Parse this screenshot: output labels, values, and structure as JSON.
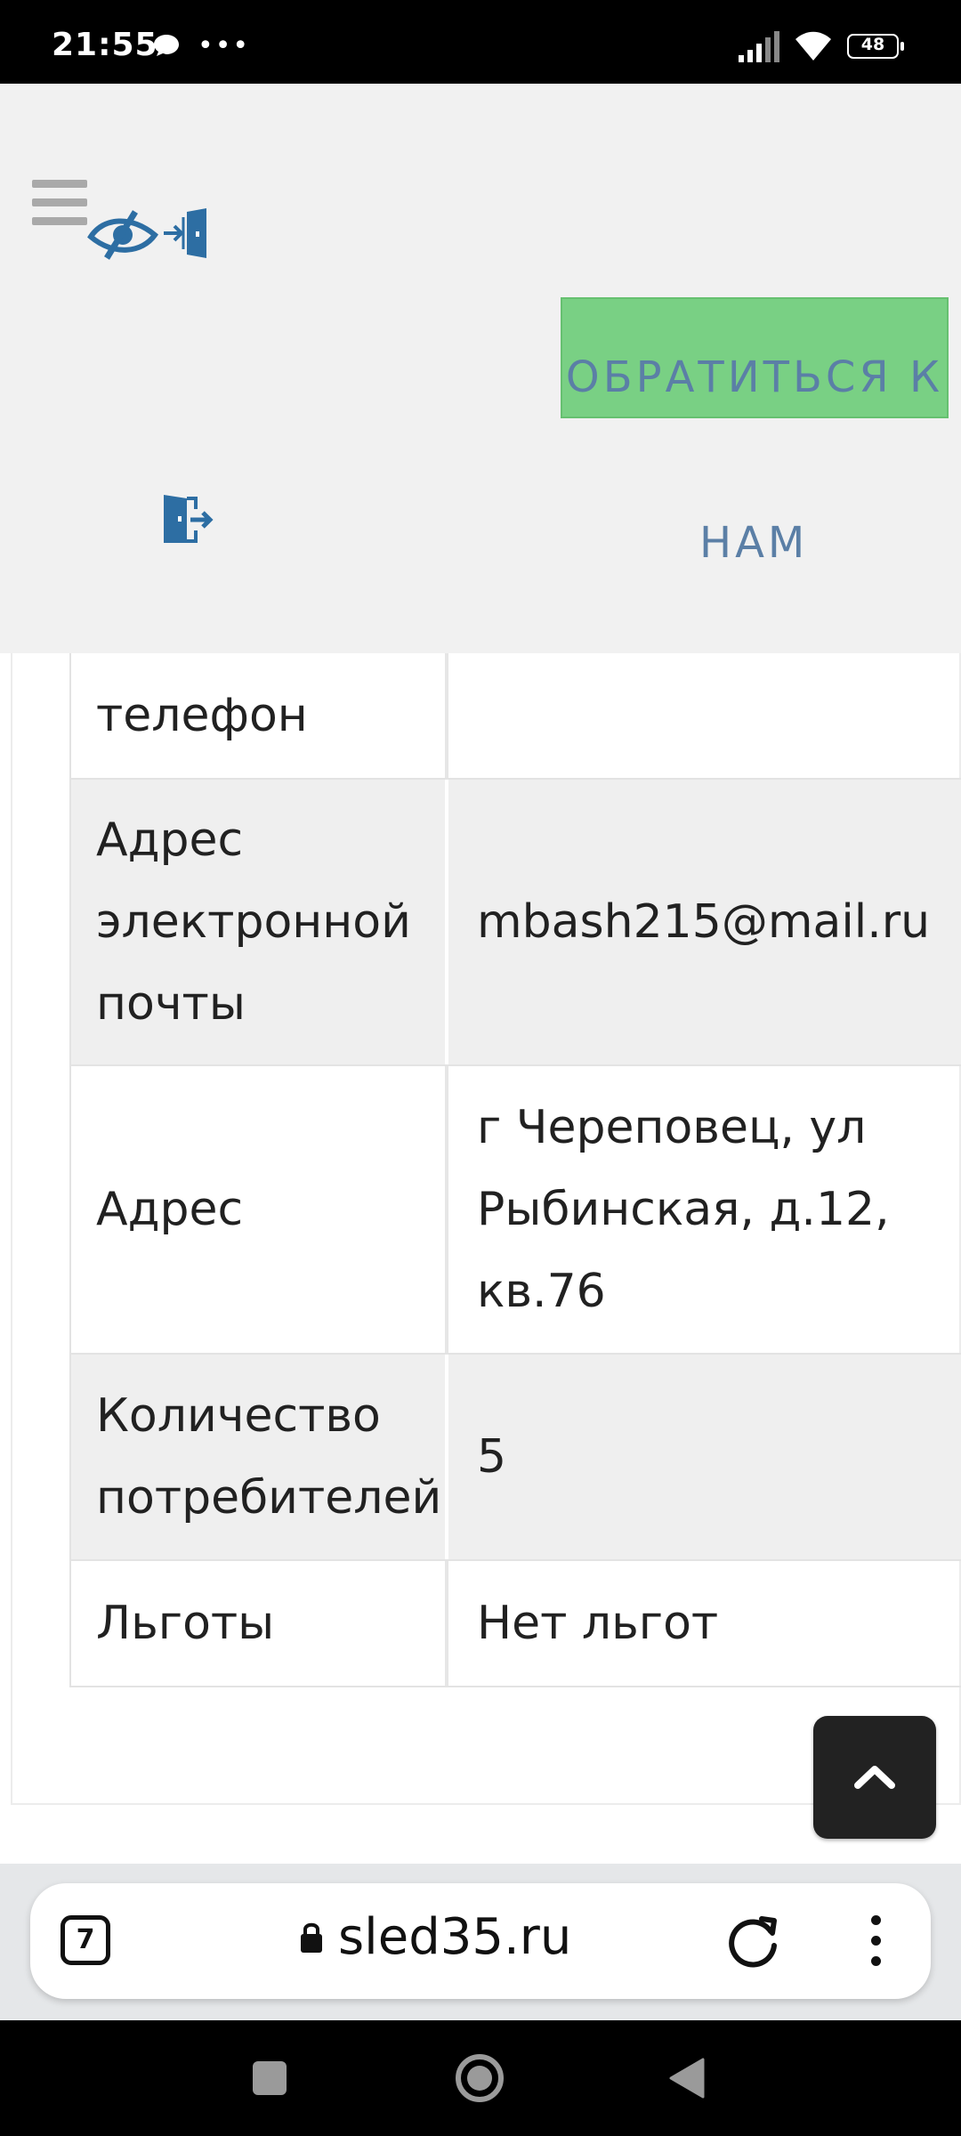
{
  "status_bar": {
    "time": "21:55",
    "dots": "•••",
    "battery": "48"
  },
  "header": {
    "contact_label_line1": "ОБРАТИТЬСЯ К",
    "contact_label_line2": "НАМ",
    "accent_color": "#79d084",
    "label_color": "#5b7fa6"
  },
  "table": {
    "rows": [
      {
        "key": "телефон",
        "value": ""
      },
      {
        "key": "Адрес электронной почты",
        "value": "mbash215@mail.ru"
      },
      {
        "key": "Адрес",
        "value": "г Череповец, ул Рыбинская, д.12, кв.76"
      },
      {
        "key": "Количество потребителей",
        "value": "5"
      },
      {
        "key": "Льготы",
        "value": "Нет льгот"
      }
    ]
  },
  "browser": {
    "tab_count": "7",
    "url": "sled35.ru"
  },
  "icons": {
    "header": [
      "menu-icon",
      "visually-impaired-icon",
      "login-icon"
    ],
    "browser": [
      "tabs-icon",
      "lock-icon",
      "reload-icon",
      "more-vert-icon"
    ],
    "nav": [
      "recents-icon",
      "home-icon",
      "back-icon"
    ]
  }
}
